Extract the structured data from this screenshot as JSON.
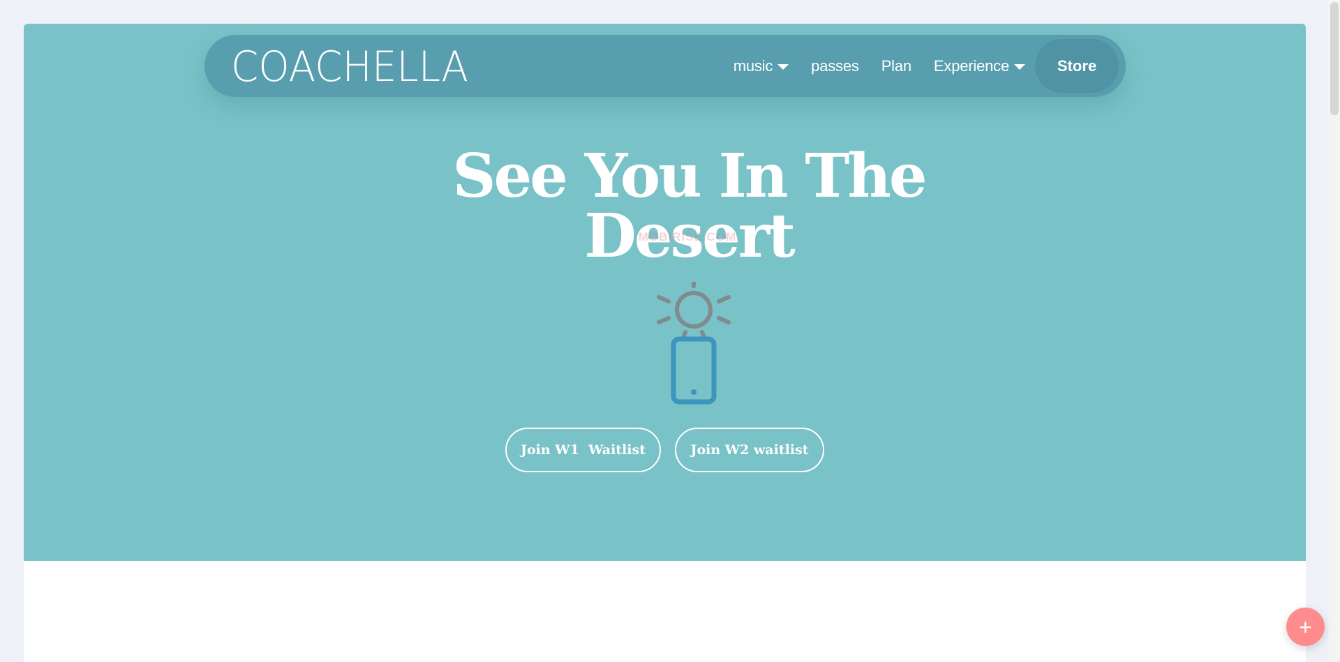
{
  "brand": {
    "logo_text": "COACHELLA"
  },
  "nav": {
    "items": [
      {
        "label": "music",
        "has_dropdown": true
      },
      {
        "label": "passes",
        "has_dropdown": false
      },
      {
        "label": "Plan",
        "has_dropdown": false
      },
      {
        "label": "Experience",
        "has_dropdown": true
      }
    ],
    "store_label": "Store"
  },
  "hero": {
    "title": "See You In The Desert",
    "watermark": "MOBIRISE.COM",
    "icon": "mobile-signal-icon",
    "buttons": [
      {
        "label": "Join W1  Waitlist"
      },
      {
        "label": "Join W2 waitlist"
      }
    ]
  },
  "fab": {
    "icon": "plus-icon",
    "label": "+"
  },
  "colors": {
    "hero_bg": "#79c2c7",
    "nav_bg": "#589eae",
    "store_bg": "#4f93a4",
    "fab_bg": "#ff8c8c",
    "icon_blue": "#3d94bd",
    "icon_gray": "#7f8b8f"
  }
}
